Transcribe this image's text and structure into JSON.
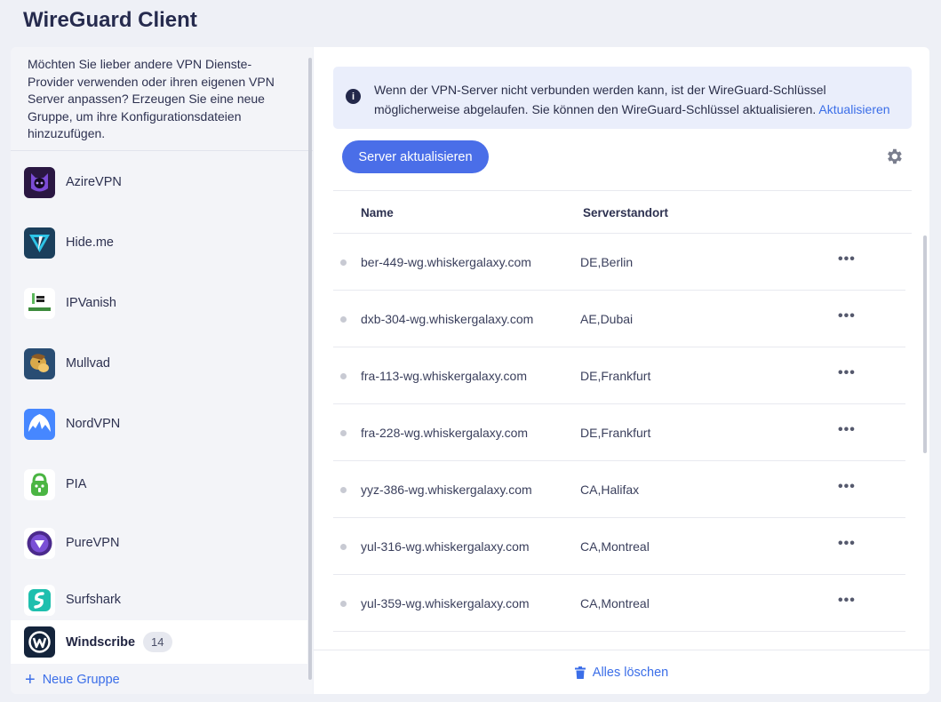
{
  "app": {
    "title": "WireGuard Client"
  },
  "sidebar": {
    "intro": "Möchten Sie lieber andere VPN Dienste-Provider verwenden oder ihren eigenen VPN Server anpassen? Erzeugen Sie eine neue Gruppe, um ihre Konfigurationsdateien hinzuzufügen.",
    "providers": [
      {
        "name": "AzireVPN",
        "icon": "azirevpn-logo"
      },
      {
        "name": "Hide.me",
        "icon": "hideme-logo"
      },
      {
        "name": "IPVanish",
        "icon": "ipvanish-logo"
      },
      {
        "name": "Mullvad",
        "icon": "mullvad-logo"
      },
      {
        "name": "NordVPN",
        "icon": "nordvpn-logo"
      },
      {
        "name": "PIA",
        "icon": "pia-logo"
      },
      {
        "name": "PureVPN",
        "icon": "purevpn-logo"
      },
      {
        "name": "Surfshark",
        "icon": "surfshark-logo"
      },
      {
        "name": "Windscribe",
        "icon": "windscribe-logo",
        "count": "14",
        "active": true
      }
    ],
    "new_group_label": "Neue Gruppe"
  },
  "main": {
    "notice": {
      "text": "Wenn der VPN-Server nicht verbunden werden kann, ist der WireGuard-Schlüssel möglicherweise abgelaufen. Sie können den WireGuard-Schlüssel aktualisieren.",
      "link": "Aktualisieren"
    },
    "update_button": "Server aktualisieren",
    "table": {
      "headers": {
        "name": "Name",
        "location": "Serverstandort"
      },
      "rows": [
        {
          "name": "ber-449-wg.whiskergalaxy.com",
          "location": "DE,Berlin"
        },
        {
          "name": "dxb-304-wg.whiskergalaxy.com",
          "location": "AE,Dubai"
        },
        {
          "name": "fra-113-wg.whiskergalaxy.com",
          "location": "DE,Frankfurt"
        },
        {
          "name": "fra-228-wg.whiskergalaxy.com",
          "location": "DE,Frankfurt"
        },
        {
          "name": "yyz-386-wg.whiskergalaxy.com",
          "location": "CA,Halifax"
        },
        {
          "name": "yul-316-wg.whiskergalaxy.com",
          "location": "CA,Montreal"
        },
        {
          "name": "yul-359-wg.whiskergalaxy.com",
          "location": "CA,Montreal"
        }
      ]
    },
    "clear_all": "Alles löschen"
  },
  "colors": {
    "accent": "#4a6ee8",
    "link": "#3b6ee8",
    "notice_bg": "#eaeefb"
  }
}
